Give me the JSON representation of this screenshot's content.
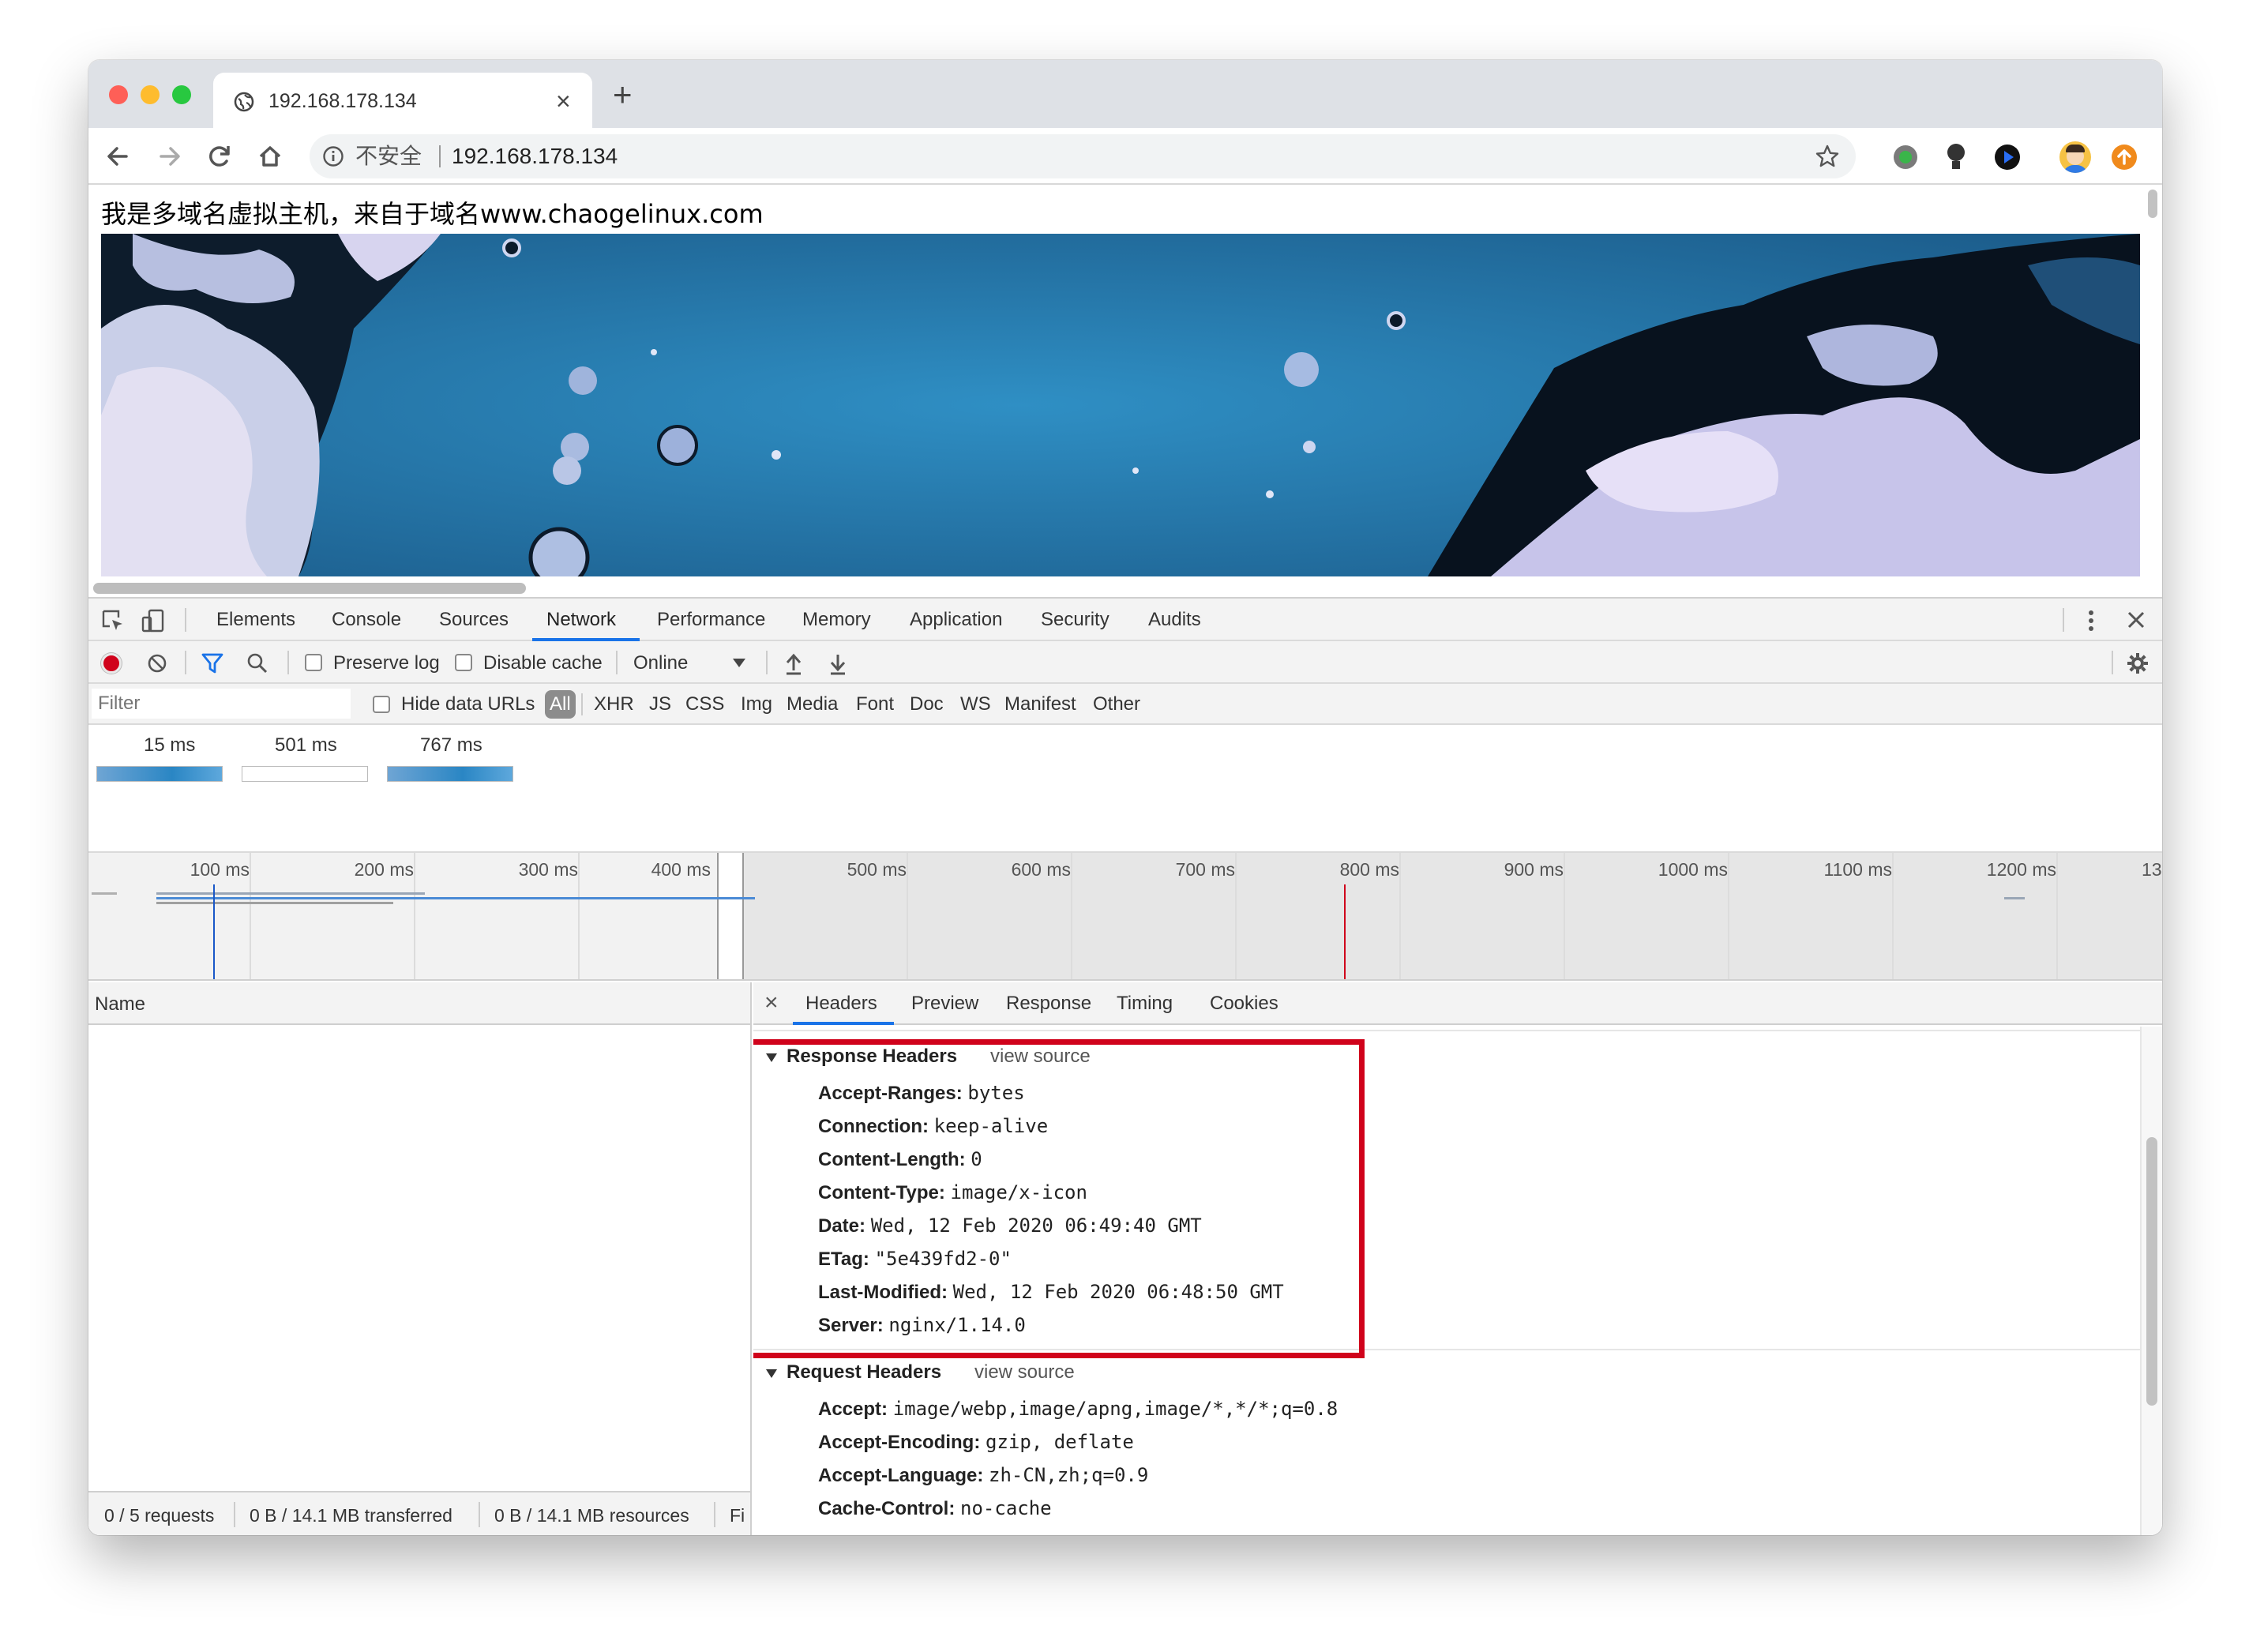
{
  "browser": {
    "tab_title": "192.168.178.134",
    "new_tab_label": "+",
    "security_label": "不安全",
    "url": "192.168.178.134"
  },
  "page": {
    "text": "我是多域名虚拟主机，来自于域名www.chaogelinux.com"
  },
  "devtools": {
    "tabs": [
      "Elements",
      "Console",
      "Sources",
      "Network",
      "Performance",
      "Memory",
      "Application",
      "Security",
      "Audits"
    ],
    "active_tab": "Network",
    "toolbar": {
      "preserve_log": "Preserve log",
      "disable_cache": "Disable cache",
      "throttle": "Online"
    },
    "filter": {
      "placeholder": "Filter",
      "hide_data_urls": "Hide data URLs",
      "types": [
        "All",
        "XHR",
        "JS",
        "CSS",
        "Img",
        "Media",
        "Font",
        "Doc",
        "WS",
        "Manifest",
        "Other"
      ]
    },
    "screenshots": [
      "15 ms",
      "501 ms",
      "767 ms"
    ],
    "timeline_ticks": [
      "100 ms",
      "200 ms",
      "300 ms",
      "400 ms",
      "500 ms",
      "600 ms",
      "700 ms",
      "800 ms",
      "900 ms",
      "1000 ms",
      "1100 ms",
      "1200 ms",
      "13"
    ],
    "name_header": "Name",
    "detail_tabs": [
      "Headers",
      "Preview",
      "Response",
      "Timing",
      "Cookies"
    ],
    "close_glyph": "×",
    "response_headers": {
      "title": "Response Headers",
      "view_source": "view source",
      "items": [
        {
          "key": "Accept-Ranges:",
          "value": "bytes"
        },
        {
          "key": "Connection:",
          "value": "keep-alive"
        },
        {
          "key": "Content-Length:",
          "value": "0"
        },
        {
          "key": "Content-Type:",
          "value": "image/x-icon"
        },
        {
          "key": "Date:",
          "value": "Wed, 12 Feb 2020 06:49:40 GMT"
        },
        {
          "key": "ETag:",
          "value": "\"5e439fd2-0\""
        },
        {
          "key": "Last-Modified:",
          "value": "Wed, 12 Feb 2020 06:48:50 GMT"
        },
        {
          "key": "Server:",
          "value": "nginx/1.14.0"
        }
      ]
    },
    "request_headers": {
      "title": "Request Headers",
      "view_source": "view source",
      "items": [
        {
          "key": "Accept:",
          "value": "image/webp,image/apng,image/*,*/*;q=0.8"
        },
        {
          "key": "Accept-Encoding:",
          "value": "gzip, deflate"
        },
        {
          "key": "Accept-Language:",
          "value": "zh-CN,zh;q=0.9"
        },
        {
          "key": "Cache-Control:",
          "value": "no-cache"
        }
      ]
    },
    "status": {
      "requests": "0 / 5 requests",
      "transferred": "0 B / 14.1 MB transferred",
      "resources": "0 B / 14.1 MB resources",
      "finish": "Fi"
    },
    "highlight_color": "#d0021b"
  }
}
